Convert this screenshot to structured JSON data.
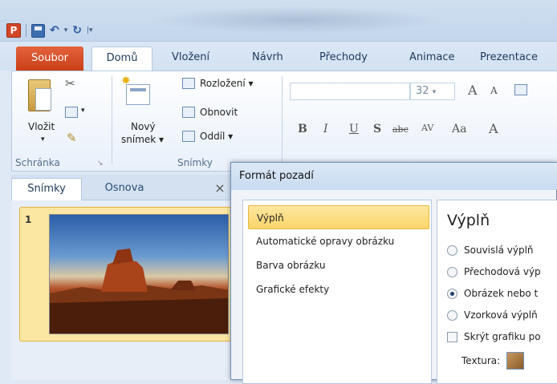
{
  "qat": {
    "app_icon": "P",
    "sep": "|"
  },
  "tabs": {
    "file": "Soubor",
    "home": "Domů",
    "insert": "Vložení",
    "design": "Návrh",
    "transitions": "Přechody",
    "animations": "Animace",
    "slideshow": "Prezentace"
  },
  "ribbon": {
    "clipboard": {
      "paste": "Vložit",
      "label": "Schránka"
    },
    "slides": {
      "new_slide_line1": "Nový",
      "new_slide_line2": "snímek ▾",
      "layout": "Rozložení ▾",
      "reset": "Obnovit",
      "section": "Oddíl ▾",
      "label": "Snímky"
    },
    "font": {
      "size": "32",
      "grow": "A",
      "shrink": "A",
      "bold": "B",
      "italic": "I",
      "underline": "U",
      "shadow": "S",
      "strike": "abc",
      "spacing": "AV",
      "case": "Aa",
      "color": "A"
    }
  },
  "panel": {
    "tab_slides": "Snímky",
    "tab_outline": "Osnova",
    "close": "×",
    "slide_number": "1"
  },
  "dialog": {
    "title": "Formát pozadí",
    "nav": [
      "Výplň",
      "Automatické opravy obrázku",
      "Barva obrázku",
      "Grafické efekty"
    ],
    "heading": "Výplň",
    "options": [
      "Souvislá výplň",
      "Přechodová výp",
      "Obrázek nebo t",
      "Vzorková výplň"
    ],
    "selected_option": 2,
    "hide_graphics": "Skrýt grafiku po",
    "texture": "Textura:"
  }
}
